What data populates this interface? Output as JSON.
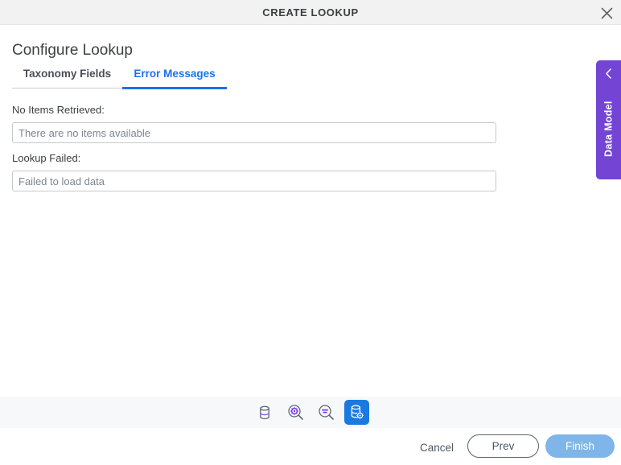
{
  "window": {
    "title": "CREATE LOOKUP",
    "close_icon": "close-icon"
  },
  "page": {
    "heading": "Configure Lookup"
  },
  "tabs": [
    {
      "label": "Taxonomy Fields",
      "active": false
    },
    {
      "label": "Error Messages",
      "active": true
    }
  ],
  "form": {
    "fields": [
      {
        "label": "No Items Retrieved:",
        "value": "There are no items available",
        "placeholder": "There are no items available"
      },
      {
        "label": "Lookup Failed:",
        "value": "Failed to load data",
        "placeholder": "Failed to load data"
      }
    ]
  },
  "side_panel": {
    "label": "Data Model",
    "chevron_icon": "chevron-left-icon"
  },
  "step_strip": {
    "steps": [
      {
        "icon": "database-icon",
        "active": false
      },
      {
        "icon": "search-gear-icon",
        "active": false
      },
      {
        "icon": "search-filter-icon",
        "active": false
      },
      {
        "icon": "database-gear-icon",
        "active": true
      }
    ]
  },
  "footer": {
    "cancel_label": "Cancel",
    "prev_label": "Prev",
    "finish_label": "Finish"
  },
  "colors": {
    "accent_blue": "#1a73e8",
    "purple": "#7444d4",
    "active_step_blue": "#1a7ae0",
    "finish_blue": "#7fb5e8",
    "titlebar_gray": "#f2f2f2",
    "strip_gray": "#f7f8fa"
  }
}
